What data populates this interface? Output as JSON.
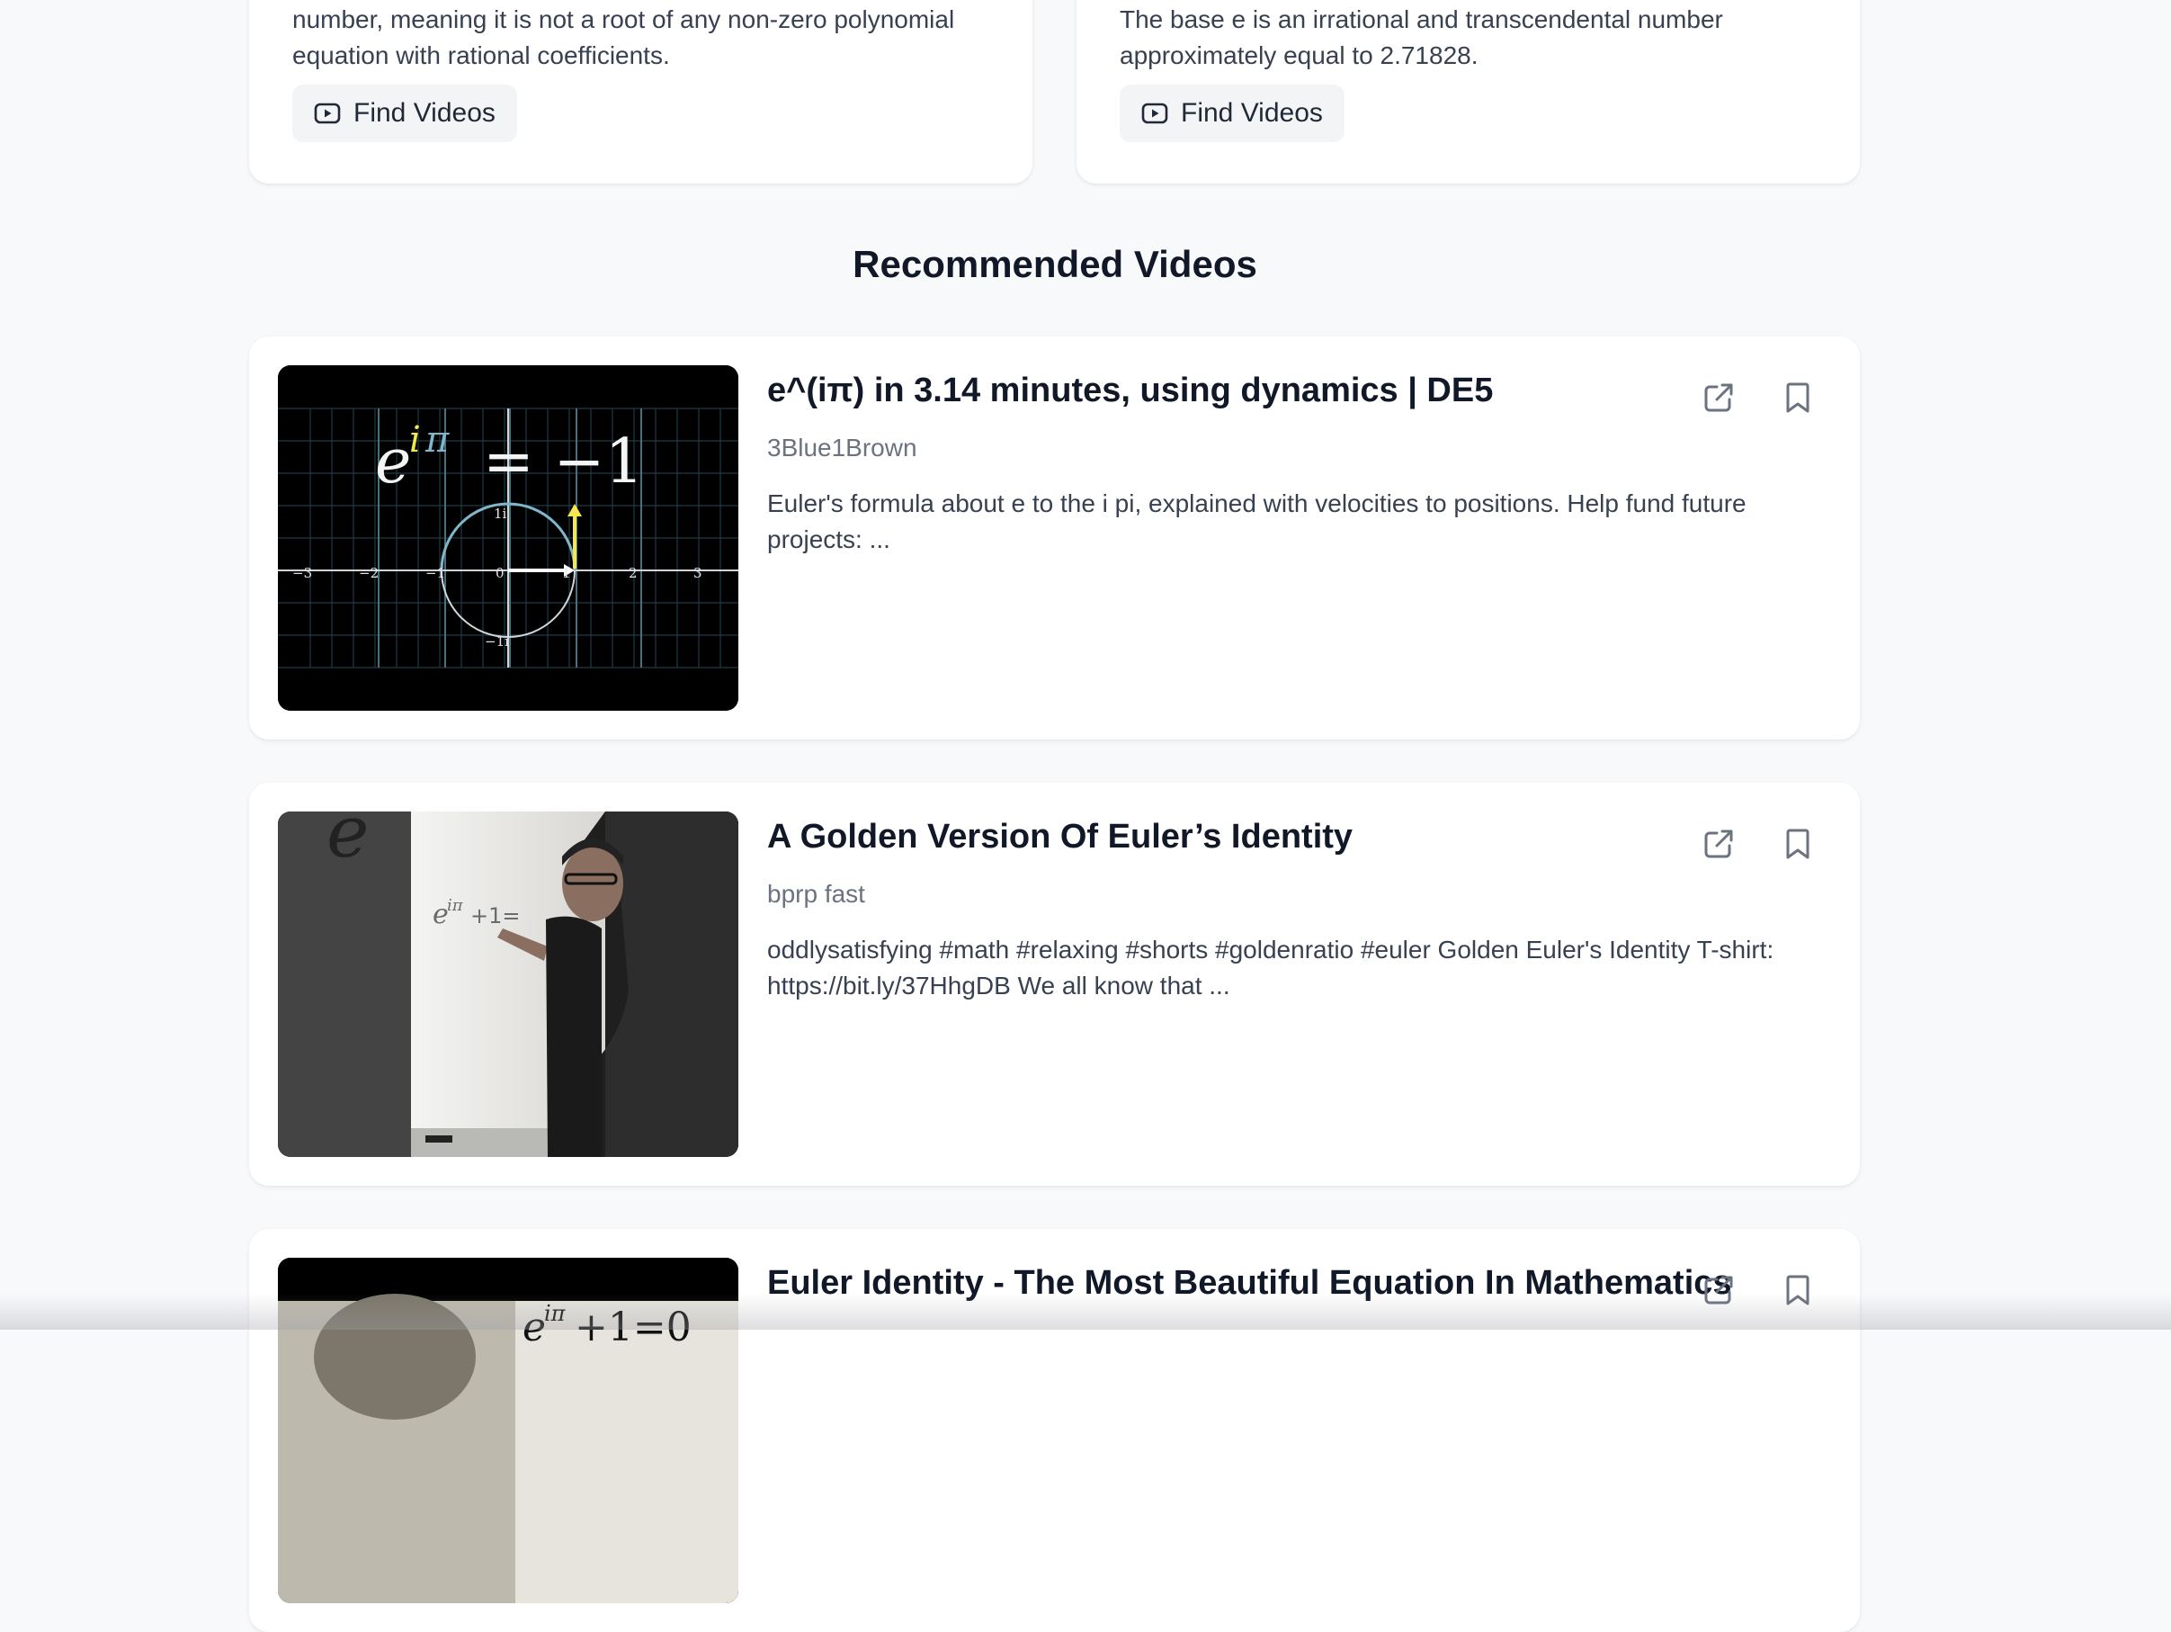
{
  "concepts": [
    {
      "desc_line1": "number, meaning it is not a root of any non-zero polynomial",
      "desc_line2": "equation with rational coefficients.",
      "button_label": "Find Videos"
    },
    {
      "desc_line1": "The base e is an irrational and transcendental number",
      "desc_line2": "approximately equal to 2.71828.",
      "button_label": "Find Videos"
    }
  ],
  "section": {
    "title": "Recommended Videos"
  },
  "videos": [
    {
      "title": "e^(iπ) in 3.14 minutes, using dynamics | DE5",
      "channel": "3Blue1Brown",
      "description": "Euler's formula about e to the i pi, explained with velocities to positions. Help fund future projects: ..."
    },
    {
      "title": "A Golden Version Of Euler’s Identity",
      "channel": "bprp fast",
      "description": "oddlysatisfying #math #relaxing #shorts #goldenratio #euler Golden Euler's Identity T-shirt: https://bit.ly/37HhgDB We all know that ..."
    },
    {
      "title": "Euler Identity - The Most Beautiful Equation In Mathematics",
      "channel": "",
      "description": ""
    }
  ],
  "icons": {
    "find_videos": "video-play-icon",
    "open": "external-link-icon",
    "save": "bookmark-icon"
  },
  "colors": {
    "background": "#f8f9fb",
    "card": "#ffffff",
    "button_bg": "#f3f4f6",
    "muted_text": "#6b7280",
    "icon": "#6b7280"
  }
}
